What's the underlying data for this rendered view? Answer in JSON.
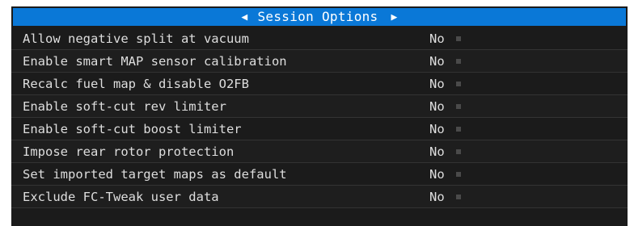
{
  "header": {
    "title": "Session Options",
    "prev_icon": "triangle-left",
    "next_icon": "triangle-right",
    "accent_color": "#0a78d7"
  },
  "options": [
    {
      "label": "Allow negative split at vacuum",
      "value": "No"
    },
    {
      "label": "Enable smart MAP sensor calibration",
      "value": "No"
    },
    {
      "label": "Recalc fuel map & disable O2FB",
      "value": "No"
    },
    {
      "label": "Enable soft-cut rev limiter",
      "value": "No"
    },
    {
      "label": "Enable soft-cut boost limiter",
      "value": "No"
    },
    {
      "label": "Impose rear rotor protection",
      "value": "No"
    },
    {
      "label": "Set imported target maps as default",
      "value": "No"
    },
    {
      "label": "Exclude FC-Tweak user data",
      "value": "No"
    }
  ]
}
